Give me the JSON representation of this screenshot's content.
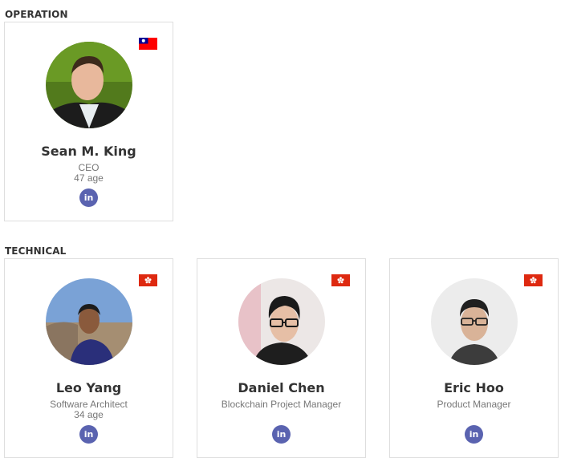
{
  "sections": {
    "operation": {
      "title": "OPERATION"
    },
    "technical": {
      "title": "TECHNICAL"
    }
  },
  "members": [
    {
      "name": "Sean M. King",
      "role": "CEO",
      "age": "47 age",
      "flag": "taiwan-flag-icon",
      "linkedin": "in"
    },
    {
      "name": "Leo Yang",
      "role": "Software Architect",
      "age": "34 age",
      "flag": "hong-kong-flag-icon",
      "linkedin": "in"
    },
    {
      "name": "Daniel Chen",
      "role": "Blockchain Project Manager",
      "flag": "hong-kong-flag-icon",
      "linkedin": "in"
    },
    {
      "name": "Eric Hoo",
      "role": "Product Manager",
      "flag": "hong-kong-flag-icon",
      "linkedin": "in"
    }
  ],
  "colors": {
    "linkedin_button": "#5a63b0",
    "hong_kong_flag": "#de2910",
    "taiwan_flag_red": "#fe0000",
    "taiwan_flag_blue": "#000095"
  }
}
